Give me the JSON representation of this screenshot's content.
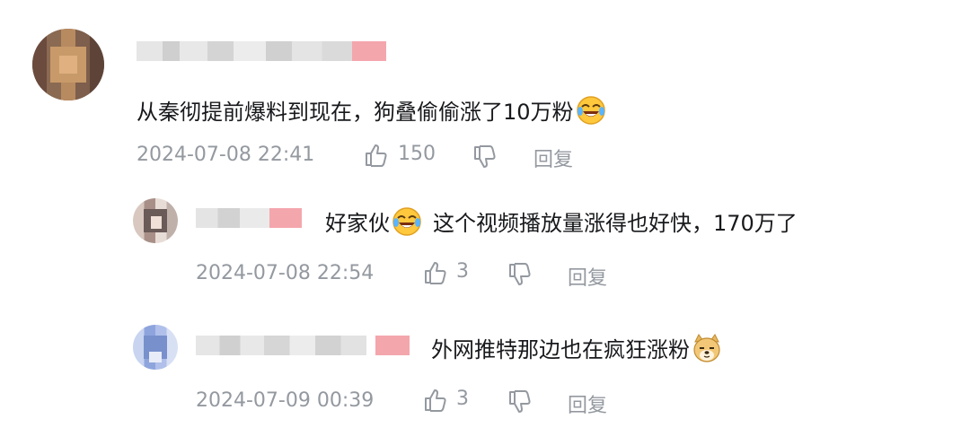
{
  "comments": [
    {
      "text": "从秦彻提前爆料到现在，狗叠偷偷涨了10万粉",
      "emoji": "laughing-crying-emoji",
      "time": "2024-07-08 22:41",
      "likes": "150",
      "reply_label": "回复"
    },
    {
      "text": "好家伙",
      "emoji": "laughing-crying-emoji",
      "text_after": "这个视频播放量涨得也好快，170万了",
      "time": "2024-07-08 22:54",
      "likes": "3",
      "reply_label": "回复"
    },
    {
      "text": "外网推特那边也在疯狂涨粉",
      "emoji": "doge-emoji",
      "time": "2024-07-09 00:39",
      "likes": "3",
      "reply_label": "回复"
    }
  ],
  "colors": {
    "text": "#18191c",
    "meta": "#9499a0",
    "badge_pink": "#f4a6ad"
  }
}
